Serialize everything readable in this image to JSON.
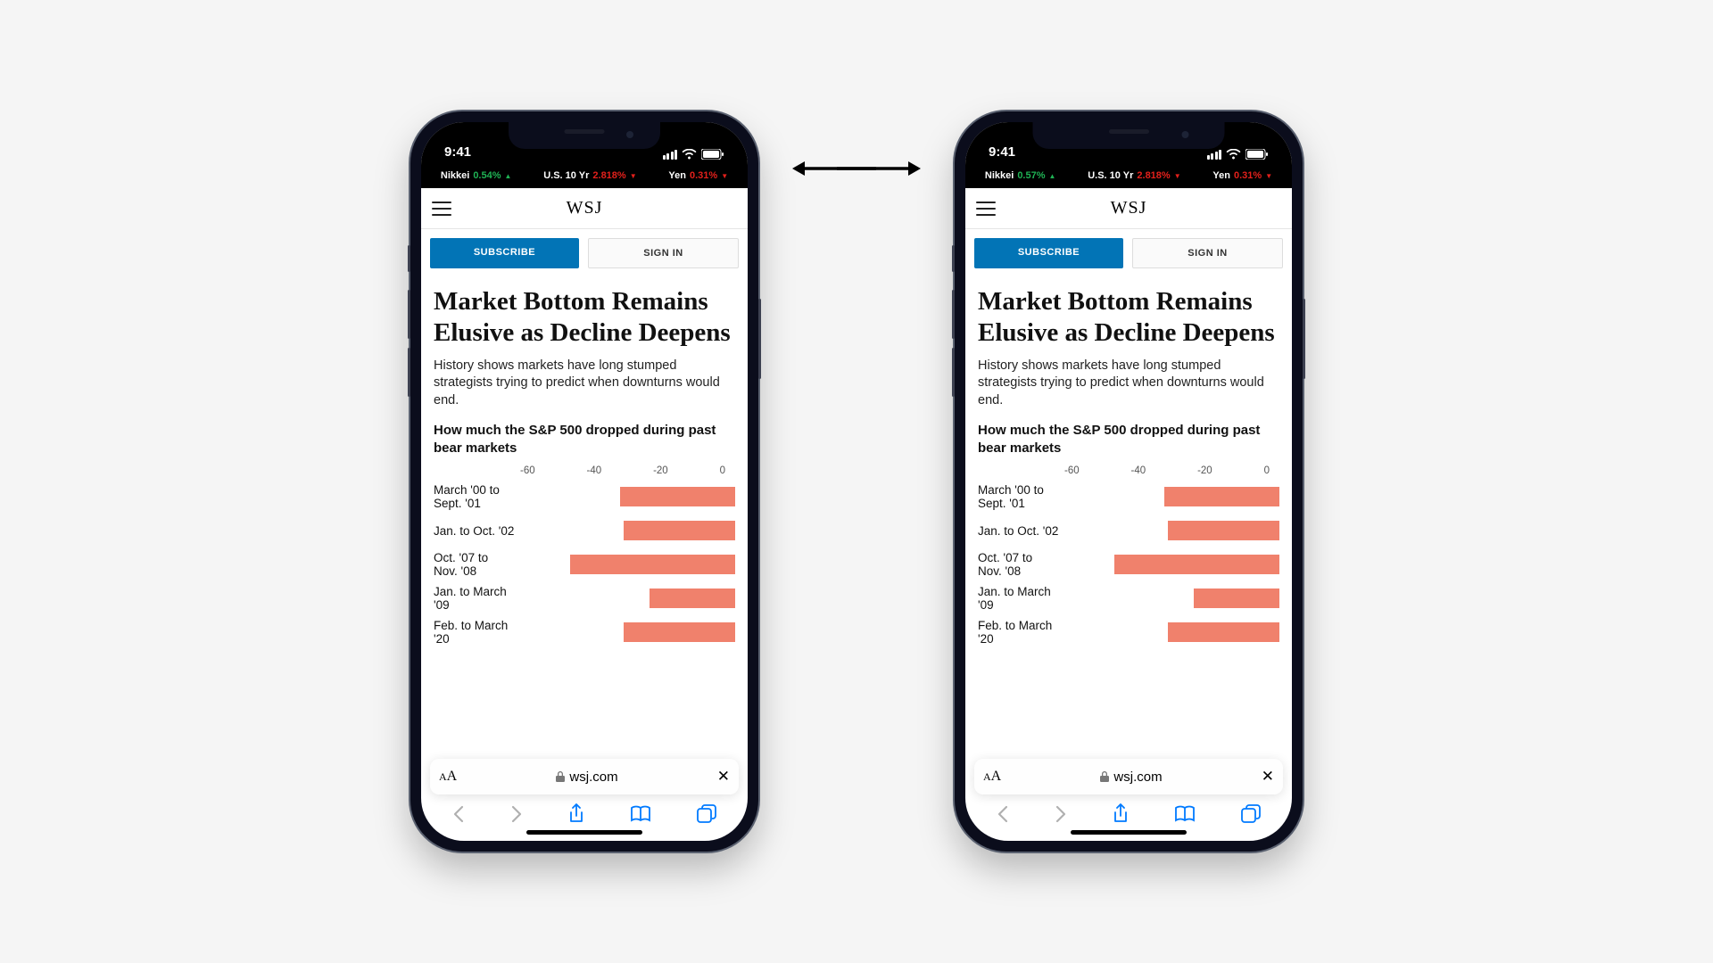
{
  "status": {
    "time": "9:41"
  },
  "tickers": [
    {
      "name": "Nikkei",
      "val": "0.54%",
      "dir": "up"
    },
    {
      "name": "U.S. 10 Yr",
      "val": "2.818%",
      "dir": "down"
    },
    {
      "name": "Yen",
      "val": "0.31%",
      "dir": "down"
    }
  ],
  "tickers2": [
    {
      "name": "Nikkei",
      "val": "0.57%",
      "dir": "up"
    },
    {
      "name": "U.S. 10 Yr",
      "val": "2.818%",
      "dir": "down"
    },
    {
      "name": "Yen",
      "val": "0.31%",
      "dir": "down"
    }
  ],
  "logo": "WSJ",
  "buttons": {
    "subscribe": "SUBSCRIBE",
    "signin": "SIGN IN"
  },
  "article": {
    "headline": "Market Bottom Remains Elusive as Decline Deepens",
    "deck": "History shows markets have long stumped strategists trying to predict when downturns would end."
  },
  "address": {
    "domain": "wsj.com"
  },
  "chart_data": {
    "type": "bar",
    "title": "How much the S&P 500 dropped during past bear markets",
    "axis_ticks": [
      "-60",
      "-40",
      "-20",
      "0"
    ],
    "xlim": [
      -60,
      0
    ],
    "categories": [
      "March '00 to Sept. '01",
      "Jan. to Oct. '02",
      "Oct. '07 to Nov. '08",
      "Jan. to March '09",
      "Feb. to March '20"
    ],
    "values": [
      -32,
      -31,
      -46,
      -24,
      -31
    ]
  }
}
